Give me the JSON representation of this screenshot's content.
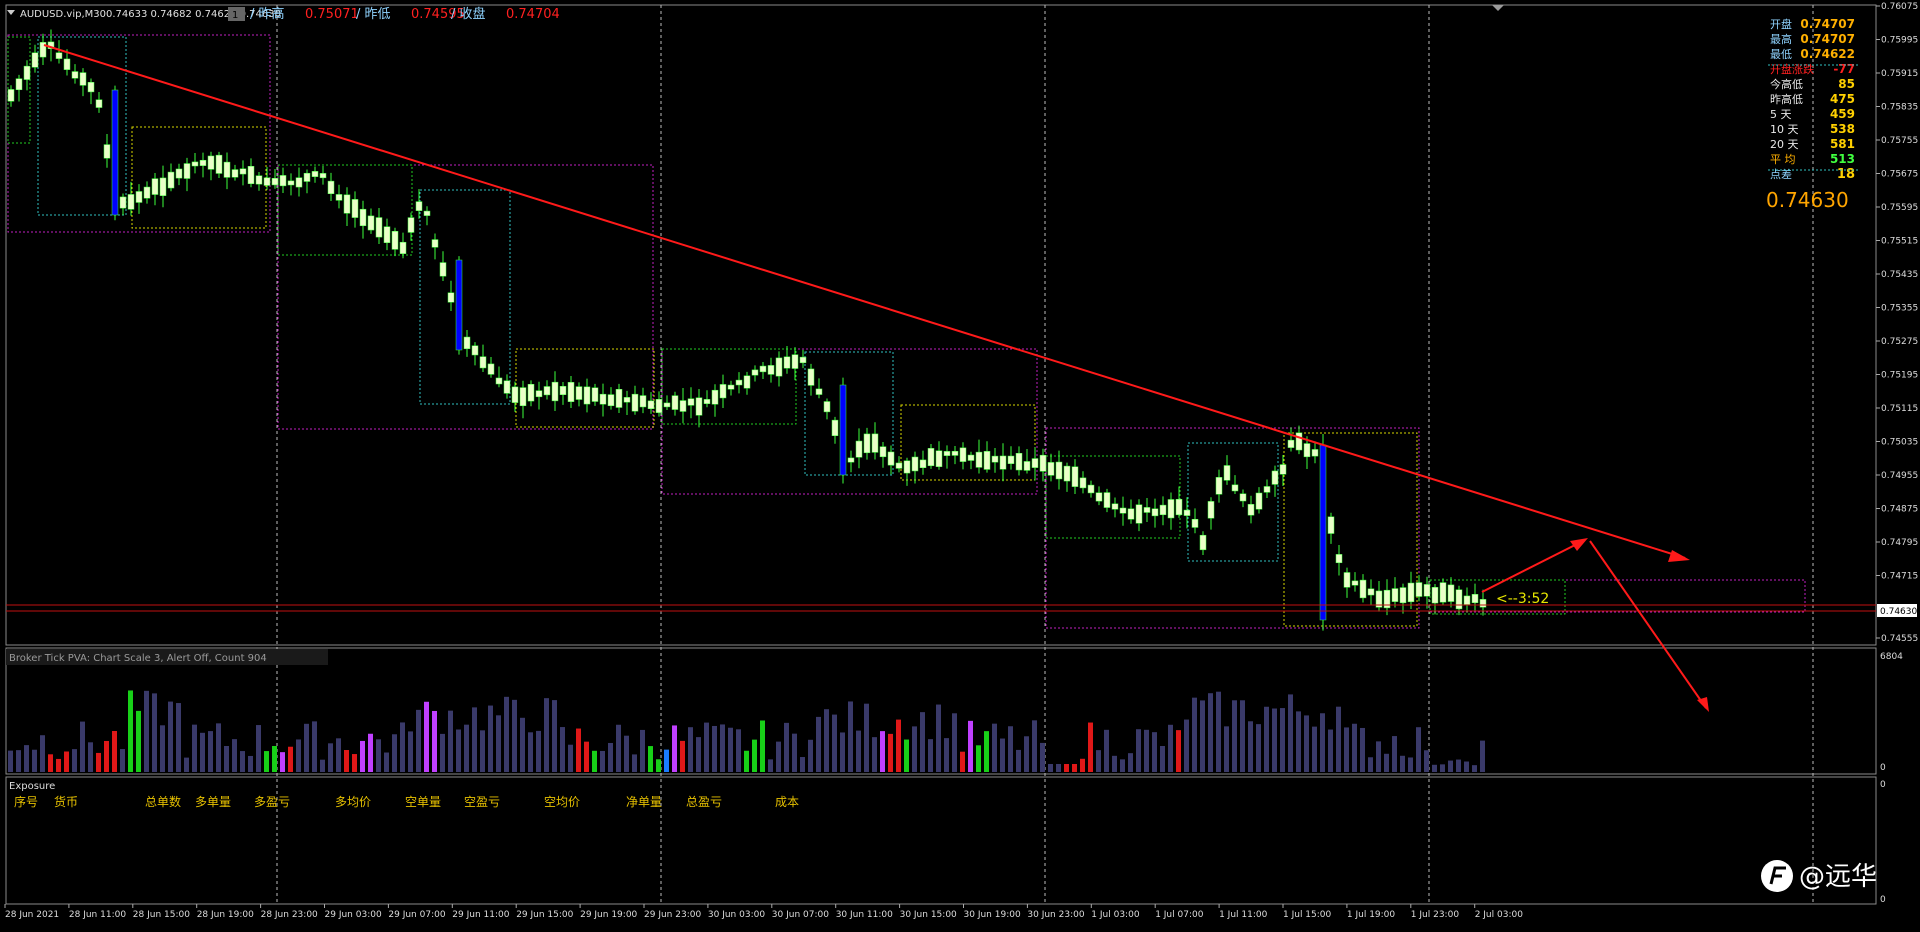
{
  "header": {
    "symbol": "AUDUSD.vip,M30",
    "ohlc": "0.74633 0.74682 0.74629 0.74630",
    "prev_high_label": "/ 昨高",
    "prev_high_value": "0.75071",
    "prev_low_label": "/ 昨低",
    "prev_low_value": "0.74595",
    "prev_close_label": "/ 收盘",
    "prev_close_value": "0.74704"
  },
  "info_panel": {
    "rows": [
      {
        "label": "开盘",
        "value": "0.74707",
        "label_color": "#8fd3ff",
        "value_color": "#ffb000"
      },
      {
        "label": "最高",
        "value": "0.74707",
        "label_color": "#8fd3ff",
        "value_color": "#ffb000"
      },
      {
        "label": "最低",
        "value": "0.74622",
        "label_color": "#8fd3ff",
        "value_color": "#ffb000"
      },
      {
        "label": "开盘涨跌",
        "value": "-77",
        "label_color": "#ff2020",
        "value_color": "#ff2020"
      },
      {
        "label": "今高低",
        "value": "85",
        "label_color": "#e8e8e8",
        "value_color": "#ffd000"
      },
      {
        "label": "昨高低",
        "value": "475",
        "label_color": "#e8e8e8",
        "value_color": "#ffd000"
      },
      {
        "label": "5   天",
        "value": "459",
        "label_color": "#e8e8e8",
        "value_color": "#ffd000"
      },
      {
        "label": "10  天",
        "value": "538",
        "label_color": "#e8e8e8",
        "value_color": "#ffd000"
      },
      {
        "label": "20  天",
        "value": "581",
        "label_color": "#e8e8e8",
        "value_color": "#ffd000"
      },
      {
        "label": "平   均",
        "value": "513",
        "label_color": "#ffb000",
        "value_color": "#40ff40"
      },
      {
        "label": "点差",
        "value": "18",
        "label_color": "#8fd3ff",
        "value_color": "#ffd000"
      }
    ],
    "big_price": "0.74630"
  },
  "price_axis": {
    "ticks": [
      "0.76075",
      "0.75995",
      "0.75915",
      "0.75835",
      "0.75755",
      "0.75675",
      "0.75595",
      "0.75515",
      "0.75435",
      "0.75355",
      "0.75275",
      "0.75195",
      "0.75115",
      "0.75035",
      "0.74955",
      "0.74875",
      "0.74795",
      "0.74715",
      "0.74630",
      "0.74555"
    ],
    "current": "0.74630"
  },
  "countdown": "<--3:52",
  "volume": {
    "title": "Broker Tick  PVA:   Chart Scale  3,  Alert Off,  Count  904",
    "max_label": "6804",
    "zero_label": "0"
  },
  "exposure": {
    "title": "Exposure",
    "columns": [
      "序号",
      "货币",
      "总单数",
      "多单量",
      "多盈亏",
      "多均价",
      "空单量",
      "空盈亏",
      "空均价",
      "净单量",
      "总盈亏",
      "成本"
    ],
    "axis_top": "0",
    "axis_bottom": "0"
  },
  "time_axis": [
    "28 Jun 2021",
    "28 Jun 11:00",
    "28 Jun 15:00",
    "28 Jun 19:00",
    "28 Jun 23:00",
    "29 Jun 03:00",
    "29 Jun 07:00",
    "29 Jun 11:00",
    "29 Jun 15:00",
    "29 Jun 19:00",
    "29 Jun 23:00",
    "30 Jun 03:00",
    "30 Jun 07:00",
    "30 Jun 11:00",
    "30 Jun 15:00",
    "30 Jun 19:00",
    "30 Jun 23:00",
    "1 Jul 03:00",
    "1 Jul 07:00",
    "1 Jul 11:00",
    "1 Jul 15:00",
    "1 Jul 19:00",
    "1 Jul 23:00",
    "2 Jul 03:00"
  ],
  "watermark": "@远华",
  "colors": {
    "background": "#000000",
    "bull_candle": "#eaffc8",
    "bear_candle": "#0000ff",
    "wick": "#3dff3d",
    "trendline": "#ff1a1a",
    "box_magenta": "#c020c0",
    "box_cyan": "#30c0c0",
    "box_yellow": "#d6d600",
    "box_green": "#22cc22",
    "volume_default": "#3a3a6a",
    "volume_red": "#e01818",
    "volume_green": "#18d018",
    "volume_magenta": "#c040ff",
    "volume_blue": "#1a7cff"
  }
}
